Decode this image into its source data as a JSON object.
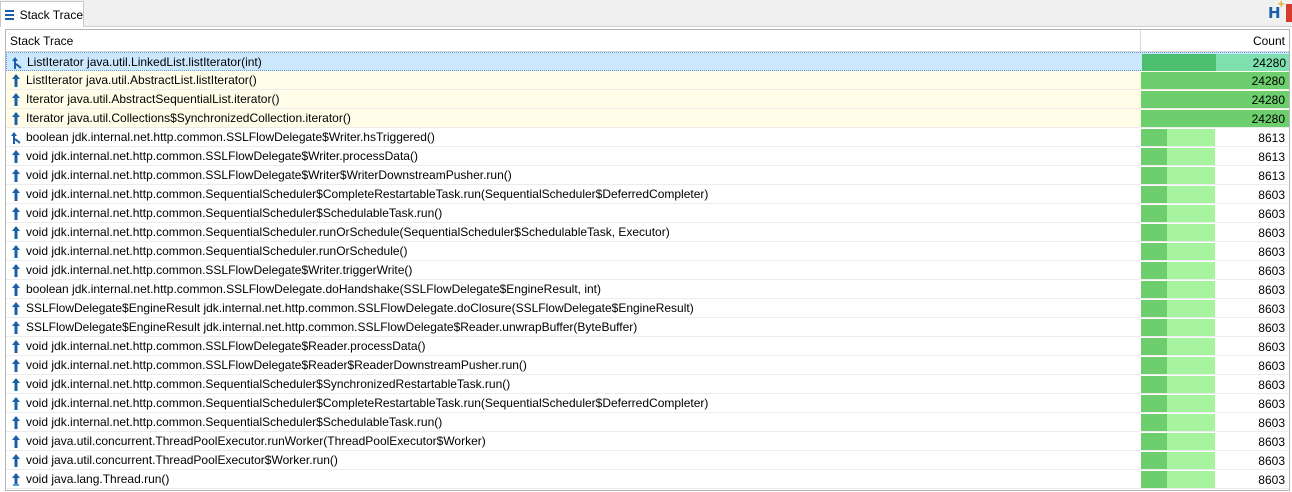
{
  "panel": {
    "tab_label": "Stack Trace",
    "tab_icon": "list-icon",
    "tool_icons": [
      "hot-methods-icon",
      "close-panel-icon"
    ]
  },
  "columns": {
    "trace": "Stack Trace",
    "count": "Count"
  },
  "colors": {
    "selected_row": "#cce8ff",
    "highlight_row": "#fffde8",
    "bar_light": "#a6f3a0",
    "bar_dark": "#6cce6c",
    "arrow_icon": "#1b5fa8"
  },
  "rows": [
    {
      "frame": "ListIterator java.util.LinkedList.listIterator(int)",
      "count": "24280",
      "icon": "branch-arrow-icon",
      "state": "selected",
      "fraction": 1.0
    },
    {
      "frame": "ListIterator java.util.AbstractList.listIterator()",
      "count": "24280",
      "icon": "up-arrow-icon",
      "state": "highlight",
      "fraction": 1.0
    },
    {
      "frame": "Iterator java.util.AbstractSequentialList.iterator()",
      "count": "24280",
      "icon": "up-arrow-icon",
      "state": "highlight",
      "fraction": 1.0
    },
    {
      "frame": "Iterator java.util.Collections$SynchronizedCollection.iterator()",
      "count": "24280",
      "icon": "up-arrow-icon",
      "state": "highlight",
      "fraction": 1.0
    },
    {
      "frame": "boolean jdk.internal.net.http.common.SSLFlowDelegate$Writer.hsTriggered()",
      "count": "8613",
      "icon": "branch-arrow-icon",
      "state": "normal",
      "fraction": 0.355
    },
    {
      "frame": "void jdk.internal.net.http.common.SSLFlowDelegate$Writer.processData()",
      "count": "8613",
      "icon": "up-arrow-icon",
      "state": "normal",
      "fraction": 0.355
    },
    {
      "frame": "void jdk.internal.net.http.common.SSLFlowDelegate$Writer$WriterDownstreamPusher.run()",
      "count": "8613",
      "icon": "up-arrow-icon",
      "state": "normal",
      "fraction": 0.355
    },
    {
      "frame": "void jdk.internal.net.http.common.SequentialScheduler$CompleteRestartableTask.run(SequentialScheduler$DeferredCompleter)",
      "count": "8603",
      "icon": "up-arrow-icon",
      "state": "normal",
      "fraction": 0.354
    },
    {
      "frame": "void jdk.internal.net.http.common.SequentialScheduler$SchedulableTask.run()",
      "count": "8603",
      "icon": "up-arrow-icon",
      "state": "normal",
      "fraction": 0.354
    },
    {
      "frame": "void jdk.internal.net.http.common.SequentialScheduler.runOrSchedule(SequentialScheduler$SchedulableTask, Executor)",
      "count": "8603",
      "icon": "up-arrow-icon",
      "state": "normal",
      "fraction": 0.354
    },
    {
      "frame": "void jdk.internal.net.http.common.SequentialScheduler.runOrSchedule()",
      "count": "8603",
      "icon": "up-arrow-icon",
      "state": "normal",
      "fraction": 0.354
    },
    {
      "frame": "void jdk.internal.net.http.common.SSLFlowDelegate$Writer.triggerWrite()",
      "count": "8603",
      "icon": "up-arrow-icon",
      "state": "normal",
      "fraction": 0.354
    },
    {
      "frame": "boolean jdk.internal.net.http.common.SSLFlowDelegate.doHandshake(SSLFlowDelegate$EngineResult, int)",
      "count": "8603",
      "icon": "up-arrow-icon",
      "state": "normal",
      "fraction": 0.354
    },
    {
      "frame": "SSLFlowDelegate$EngineResult jdk.internal.net.http.common.SSLFlowDelegate.doClosure(SSLFlowDelegate$EngineResult)",
      "count": "8603",
      "icon": "up-arrow-icon",
      "state": "normal",
      "fraction": 0.354
    },
    {
      "frame": "SSLFlowDelegate$EngineResult jdk.internal.net.http.common.SSLFlowDelegate$Reader.unwrapBuffer(ByteBuffer)",
      "count": "8603",
      "icon": "up-arrow-icon",
      "state": "normal",
      "fraction": 0.354
    },
    {
      "frame": "void jdk.internal.net.http.common.SSLFlowDelegate$Reader.processData()",
      "count": "8603",
      "icon": "up-arrow-icon",
      "state": "normal",
      "fraction": 0.354
    },
    {
      "frame": "void jdk.internal.net.http.common.SSLFlowDelegate$Reader$ReaderDownstreamPusher.run()",
      "count": "8603",
      "icon": "up-arrow-icon",
      "state": "normal",
      "fraction": 0.354
    },
    {
      "frame": "void jdk.internal.net.http.common.SequentialScheduler$SynchronizedRestartableTask.run()",
      "count": "8603",
      "icon": "up-arrow-icon",
      "state": "normal",
      "fraction": 0.354
    },
    {
      "frame": "void jdk.internal.net.http.common.SequentialScheduler$CompleteRestartableTask.run(SequentialScheduler$DeferredCompleter)",
      "count": "8603",
      "icon": "up-arrow-icon",
      "state": "normal",
      "fraction": 0.354
    },
    {
      "frame": "void jdk.internal.net.http.common.SequentialScheduler$SchedulableTask.run()",
      "count": "8603",
      "icon": "up-arrow-icon",
      "state": "normal",
      "fraction": 0.354
    },
    {
      "frame": "void java.util.concurrent.ThreadPoolExecutor.runWorker(ThreadPoolExecutor$Worker)",
      "count": "8603",
      "icon": "up-arrow-icon",
      "state": "normal",
      "fraction": 0.354
    },
    {
      "frame": "void java.util.concurrent.ThreadPoolExecutor$Worker.run()",
      "count": "8603",
      "icon": "up-arrow-icon",
      "state": "normal",
      "fraction": 0.354
    },
    {
      "frame": "void java.lang.Thread.run()",
      "count": "8603",
      "icon": "root-arrow-icon",
      "state": "normal",
      "fraction": 0.354
    }
  ]
}
